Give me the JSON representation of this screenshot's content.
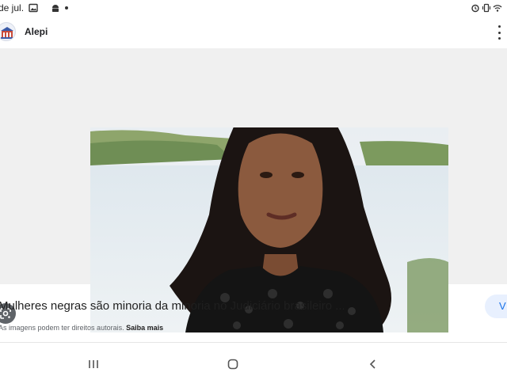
{
  "status_bar": {
    "time": "de jul.",
    "icons": [
      "image-icon",
      "android-icon",
      "notification-dot",
      "alarm-icon",
      "vibrate-icon",
      "wifi-icon"
    ]
  },
  "header": {
    "site_name": "Alepi",
    "logo_icon": "alepi-logo",
    "menu_icon": "more-vert-icon"
  },
  "image": {
    "description_icon": "google-lens-icon"
  },
  "result": {
    "title": "Mulheres negras são minoria da minoria no Judiciário brasileiro ...",
    "visit_label": "V",
    "copyright_text": "As imagens podem ter direitos autorais.",
    "learn_more": "Saiba mais"
  },
  "nav": {
    "icons": [
      "recents-icon",
      "home-icon",
      "back-icon"
    ]
  },
  "colors": {
    "accent": "#1a73e8",
    "visit_bg": "#e8f0fe"
  }
}
